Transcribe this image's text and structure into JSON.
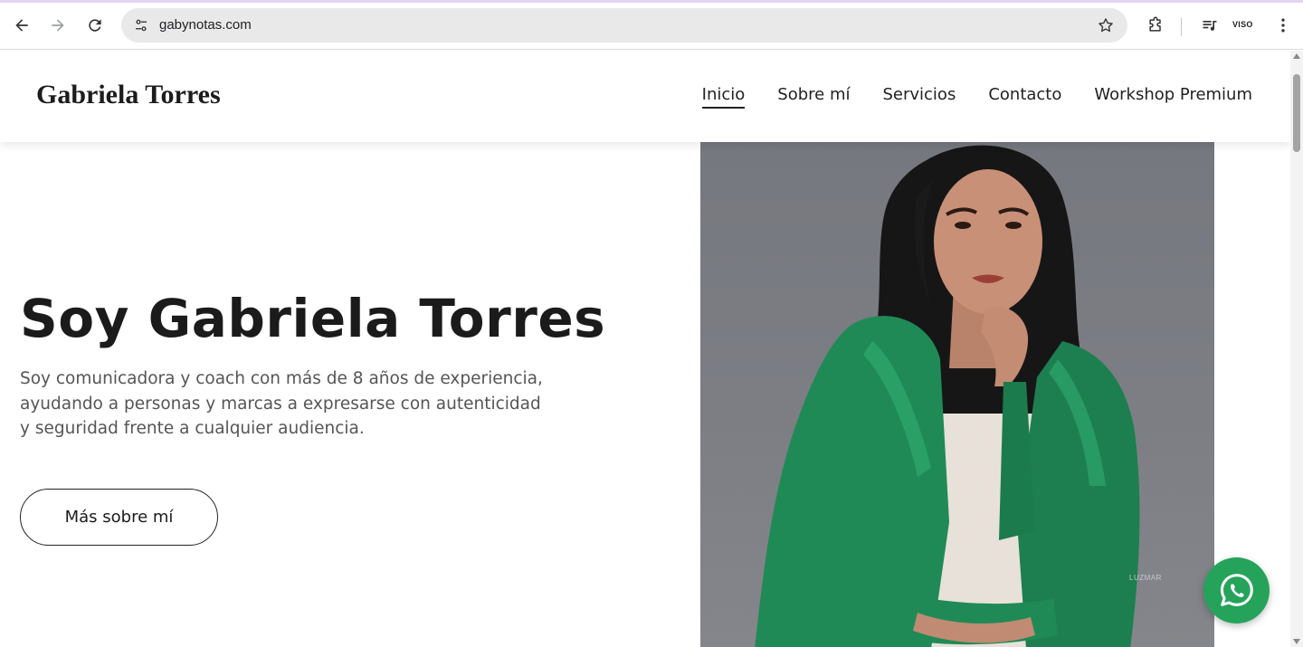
{
  "browser": {
    "url": "gabynotas.com",
    "extension_label": "VISO",
    "icons": {
      "back": "arrow-left-icon",
      "forward": "arrow-right-icon",
      "reload": "reload-icon",
      "site_info": "tune-icon",
      "bookmark": "star-icon",
      "extensions": "puzzle-icon",
      "media": "playlist-icon",
      "menu": "kebab-menu-icon"
    }
  },
  "header": {
    "brand": "Gabriela Torres",
    "nav": [
      "Inicio",
      "Sobre mí",
      "Servicios",
      "Contacto",
      "Workshop Premium"
    ],
    "active_nav": "Inicio"
  },
  "hero": {
    "title": "Soy Gabriela Torres",
    "description": "Soy comunicadora y coach con más de 8 años de experiencia, ayudando a personas y marcas a expresarse con autenticidad y seguridad frente a cualquier audiencia.",
    "button": "Más sobre mí"
  },
  "photo": {
    "watermark": "LUZMAR",
    "jacket_color": "#1f8a55",
    "background_color": "#7b7d83"
  },
  "floating": {
    "icon": "whatsapp-icon",
    "color": "#25a35a"
  }
}
